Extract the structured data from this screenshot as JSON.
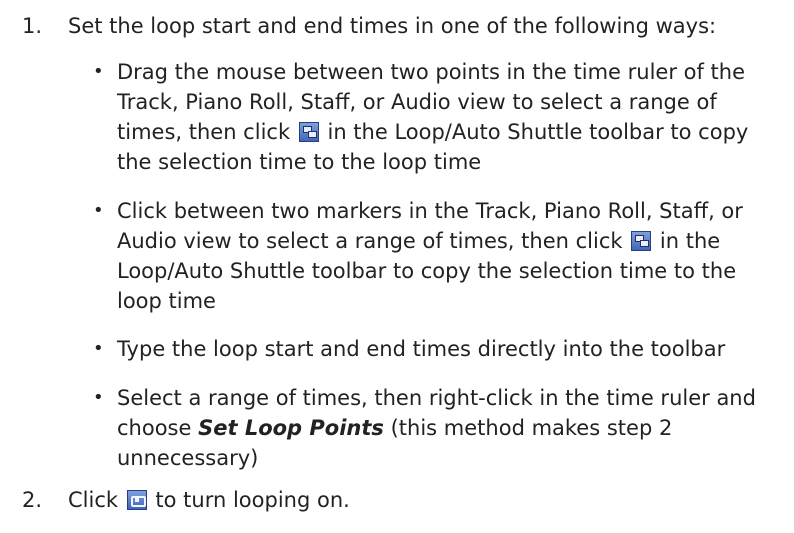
{
  "steps": [
    {
      "number": "1.",
      "text": "Set the loop start and end times in one of the following ways:"
    },
    {
      "number": "2.",
      "text_before": "Click",
      "icon": "loop-toggle-icon",
      "text_after": "to turn looping on."
    }
  ],
  "bullets": [
    {
      "marker": "•",
      "text_before": "Drag the mouse between two points in the time ruler of the Track, Piano Roll, Staff, or Audio view to select a range of times, then click",
      "icon": "selection-to-loop-icon",
      "text_after": "in the Loop/Auto Shuttle toolbar to copy the selection time to the loop time"
    },
    {
      "marker": "•",
      "text_before": "Click between two markers in the Track, Piano Roll, Staff, or Audio view to select a range of times, then click",
      "icon": "selection-to-loop-icon",
      "text_after": "in the Loop/Auto Shuttle toolbar to copy the selection time to the loop time"
    },
    {
      "marker": "•",
      "text": "Type the loop start and end times directly into the toolbar"
    },
    {
      "marker": "•",
      "text_before": "Select a range of times, then right-click in the time ruler and choose",
      "emphasis": "Set Loop Points",
      "text_after": "(this method makes step 2 unnecessary)"
    }
  ]
}
